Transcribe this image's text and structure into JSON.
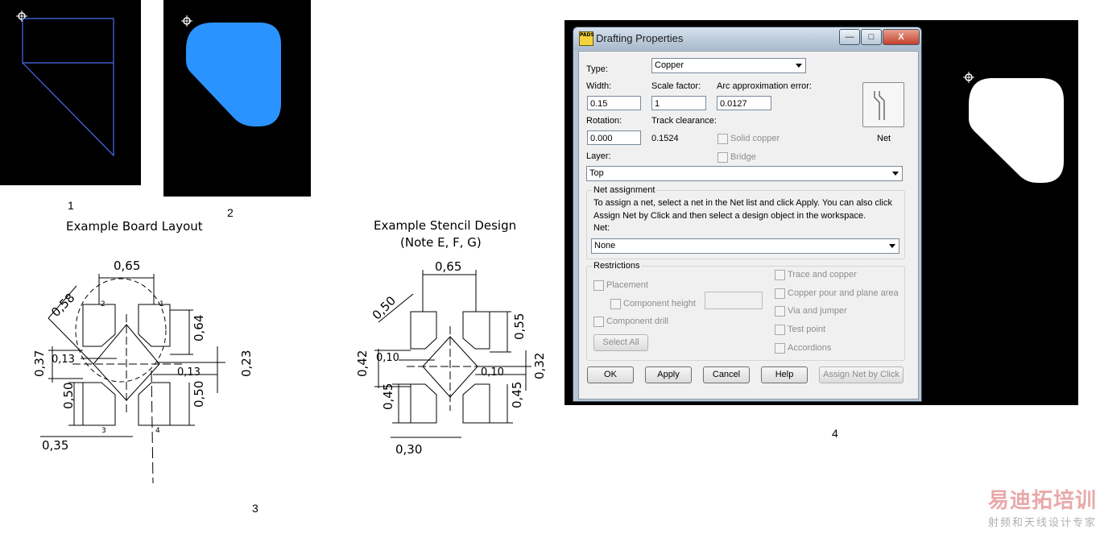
{
  "figure_labels": {
    "fig1": "1",
    "fig2": "2",
    "fig3": "3",
    "fig4": "4"
  },
  "drawing": {
    "board_title": "Example Board Layout",
    "stencil_title": "Example Stencil Design",
    "stencil_note": "(Note E, F, G)",
    "board_dims": [
      "0,65",
      "0,58",
      "0,64",
      "0,37",
      "0,13",
      "0,13",
      "0,23",
      "0,50",
      "0,50",
      "0,35"
    ],
    "board_pins": [
      "2",
      "1",
      "3",
      "4"
    ],
    "stencil_dims": [
      "0,65",
      "0,50",
      "0,55",
      "0,42",
      "0,10",
      "0,10",
      "0,32",
      "0,45",
      "0,45",
      "0,30"
    ]
  },
  "dialog": {
    "app_badge": "PADS",
    "title": "Drafting Properties",
    "window_buttons": {
      "minimize": "—",
      "maximize": "□",
      "close": "X"
    },
    "type_label": "Type:",
    "type_value": "Copper",
    "width_label": "Width:",
    "width_value": "0.15",
    "scale_label": "Scale factor:",
    "scale_value": "1",
    "arc_label": "Arc approximation error:",
    "arc_value": "0.0127",
    "rotation_label": "Rotation:",
    "rotation_value": "0.000",
    "track_label": "Track clearance:",
    "track_value": "0.1524",
    "solid_copper_label": "Solid copper",
    "bridge_label": "Bridge",
    "net_button_label": "Net",
    "layer_label": "Layer:",
    "layer_value": "Top",
    "net_assignment": {
      "title": "Net assignment",
      "info_line1": "To assign a net, select a net in the Net list and click Apply. You can also click",
      "info_line2": "Assign Net by Click and then select a design object in the workspace.",
      "net_label": "Net:",
      "net_value": "None"
    },
    "restrictions": {
      "title": "Restrictions",
      "placement": "Placement",
      "component_height": "Component height",
      "component_drill": "Component drill",
      "select_all": "Select All",
      "trace_copper": "Trace and copper",
      "copper_pour": "Copper pour and plane area",
      "via_jumper": "Via and jumper",
      "test_point": "Test point",
      "accordions": "Accordions"
    },
    "buttons": {
      "ok": "OK",
      "apply": "Apply",
      "cancel": "Cancel",
      "help": "Help",
      "assign_net": "Assign Net by Click"
    }
  },
  "watermark": {
    "main": "易迪拓培训",
    "sub": "射频和天线设计专家"
  },
  "colors": {
    "shape_fill": "#2b93ff",
    "outline": "#4a6cf0",
    "background": "#000000"
  }
}
